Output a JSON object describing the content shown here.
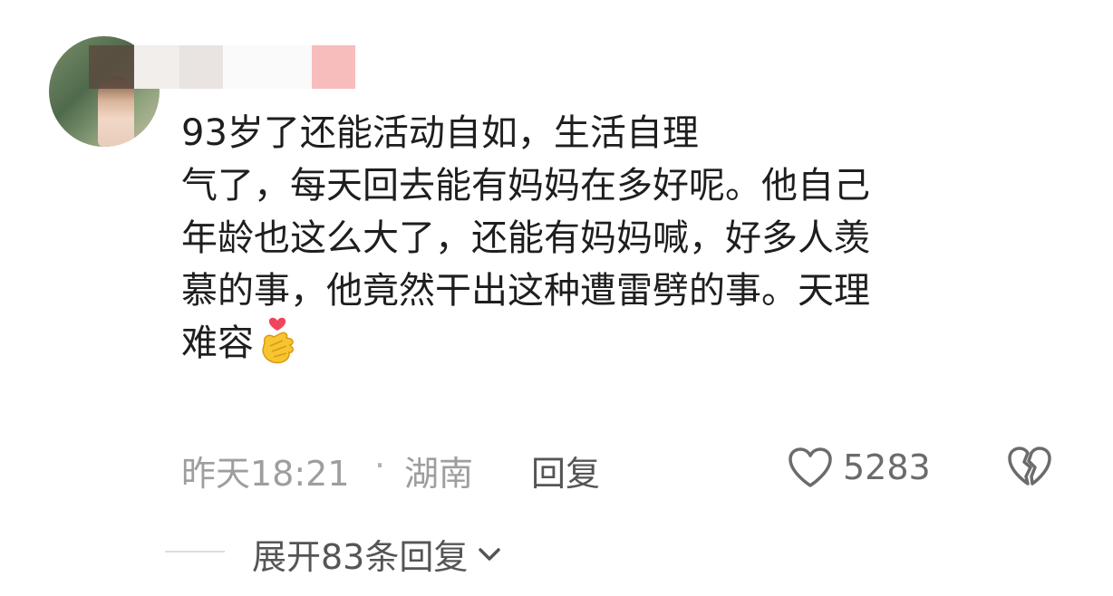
{
  "comment": {
    "text_lines": [
      "93岁了还能活动自如，生活自理",
      "气了，每天回去能有妈妈在多好呢。他自己",
      "年龄也这么大了，还能有妈妈喊，好多人羡",
      "慕的事，他竟然干出这种遭雷劈的事。天理",
      "难容"
    ],
    "emoji": "finger-heart-emoji"
  },
  "meta": {
    "time": "昨天18:21",
    "separator": "·",
    "location": "湖南",
    "reply_label": "回复",
    "like_count": "5283"
  },
  "replies": {
    "expand_label": "展开83条回复"
  },
  "icons": {
    "like": "heart-outline-icon",
    "dislike": "broken-heart-icon",
    "expand": "chevron-down-icon"
  },
  "colors": {
    "text": "#1e1e1e",
    "muted": "#9e9e9e",
    "action": "#555555"
  }
}
